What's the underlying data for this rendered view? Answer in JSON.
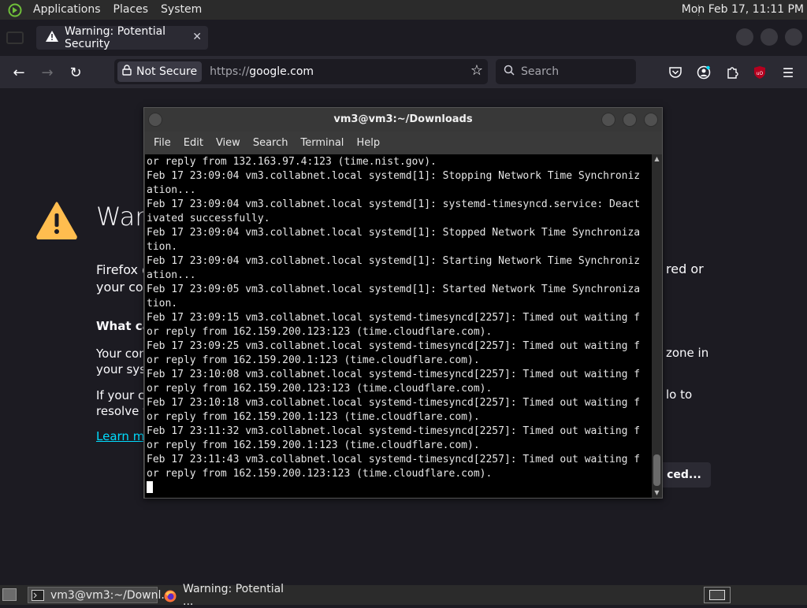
{
  "system_panel": {
    "menus": [
      "Applications",
      "Places",
      "System"
    ],
    "clock": "Mon Feb 17, 11:11 PM"
  },
  "browser": {
    "tab_title": "Warning: Potential Security",
    "security_label": "Not Secure",
    "url_scheme": "https://",
    "url_host": "google.com",
    "search_placeholder": "Search"
  },
  "warning_page": {
    "title_fragment": "War",
    "p1_left_fragment_1": "Firefox d",
    "p1_left_fragment_2": "your com",
    "p1_right_fragment": "red or",
    "what_can_fragment": "What can",
    "p2_left_fragment_1": "Your com",
    "p2_left_fragment_2": "your syst",
    "p2_right_fragment": "zone in",
    "p3_left_fragment_1": "If your clo",
    "p3_left_fragment_2": "resolve th",
    "p3_right_fragment": "lo to",
    "learn_more_fragment": "Learn mo",
    "advanced_fragment": "ced..."
  },
  "terminal": {
    "title": "vm3@vm3:~/Downloads",
    "menus": [
      "File",
      "Edit",
      "View",
      "Search",
      "Terminal",
      "Help"
    ],
    "lines": [
      "or reply from 132.163.97.4:123 (time.nist.gov).",
      "Feb 17 23:09:04 vm3.collabnet.local systemd[1]: Stopping Network Time Synchroniz",
      "ation...",
      "Feb 17 23:09:04 vm3.collabnet.local systemd[1]: systemd-timesyncd.service: Deact",
      "ivated successfully.",
      "Feb 17 23:09:04 vm3.collabnet.local systemd[1]: Stopped Network Time Synchroniza",
      "tion.",
      "Feb 17 23:09:04 vm3.collabnet.local systemd[1]: Starting Network Time Synchroniz",
      "ation...",
      "Feb 17 23:09:05 vm3.collabnet.local systemd[1]: Started Network Time Synchroniza",
      "tion.",
      "Feb 17 23:09:15 vm3.collabnet.local systemd-timesyncd[2257]: Timed out waiting f",
      "or reply from 162.159.200.123:123 (time.cloudflare.com).",
      "Feb 17 23:09:25 vm3.collabnet.local systemd-timesyncd[2257]: Timed out waiting f",
      "or reply from 162.159.200.1:123 (time.cloudflare.com).",
      "Feb 17 23:10:08 vm3.collabnet.local systemd-timesyncd[2257]: Timed out waiting f",
      "or reply from 162.159.200.123:123 (time.cloudflare.com).",
      "Feb 17 23:10:18 vm3.collabnet.local systemd-timesyncd[2257]: Timed out waiting f",
      "or reply from 162.159.200.1:123 (time.cloudflare.com).",
      "Feb 17 23:11:32 vm3.collabnet.local systemd-timesyncd[2257]: Timed out waiting f",
      "or reply from 162.159.200.1:123 (time.cloudflare.com).",
      "Feb 17 23:11:43 vm3.collabnet.local systemd-timesyncd[2257]: Timed out waiting f",
      "or reply from 162.159.200.123:123 (time.cloudflare.com)."
    ]
  },
  "taskbar": {
    "tasks": [
      "vm3@vm3:~/Downl...",
      "Warning: Potential ..."
    ]
  },
  "colors": {
    "accent_link": "#00ddff",
    "warning_yellow": "#ffbd4f"
  }
}
